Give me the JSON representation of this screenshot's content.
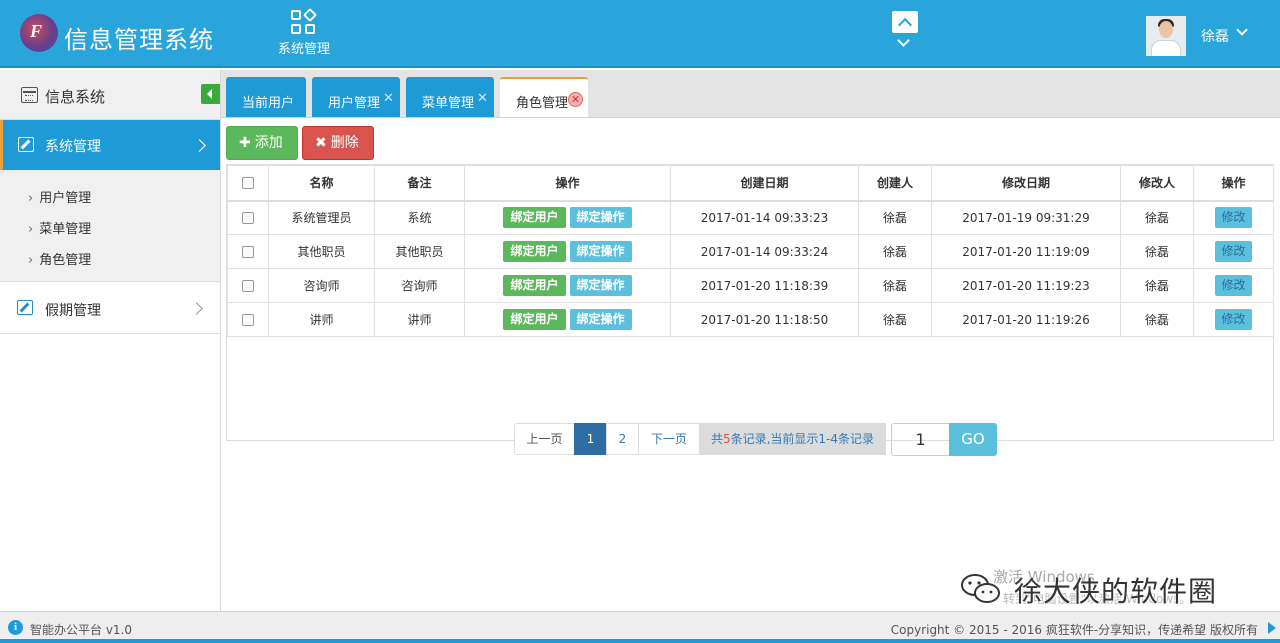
{
  "header": {
    "app_title": "信息管理系统",
    "module_label": "系统管理",
    "user_name": "徐磊"
  },
  "sidebar": {
    "group_label": "信息系统",
    "active_item": "系统管理",
    "sub_items": [
      "用户管理",
      "菜单管理",
      "角色管理"
    ],
    "item2": "假期管理"
  },
  "tabs": [
    {
      "label": "当前用户",
      "closable": false
    },
    {
      "label": "用户管理",
      "closable": true
    },
    {
      "label": "菜单管理",
      "closable": true
    },
    {
      "label": "角色管理",
      "closable": true,
      "active": true
    }
  ],
  "toolbar": {
    "add_label": "添加",
    "delete_label": "删除"
  },
  "table": {
    "columns": [
      "名称",
      "备注",
      "操作",
      "创建日期",
      "创建人",
      "修改日期",
      "修改人",
      "操作"
    ],
    "bind_user_label": "绑定用户",
    "bind_op_label": "绑定操作",
    "edit_label": "修改",
    "rows": [
      {
        "name": "系统管理员",
        "remark": "系统",
        "created": "2017-01-14 09:33:23",
        "creator": "徐磊",
        "modified": "2017-01-19 09:31:29",
        "modifier": "徐磊"
      },
      {
        "name": "其他职员",
        "remark": "其他职员",
        "created": "2017-01-14 09:33:24",
        "creator": "徐磊",
        "modified": "2017-01-20 11:19:09",
        "modifier": "徐磊"
      },
      {
        "name": "咨询师",
        "remark": "咨询师",
        "created": "2017-01-20 11:18:39",
        "creator": "徐磊",
        "modified": "2017-01-20 11:19:23",
        "modifier": "徐磊"
      },
      {
        "name": "讲师",
        "remark": "讲师",
        "created": "2017-01-20 11:18:50",
        "creator": "徐磊",
        "modified": "2017-01-20 11:19:26",
        "modifier": "徐磊"
      }
    ]
  },
  "pager": {
    "prev": "上一页",
    "pages": [
      "1",
      "2"
    ],
    "current": "1",
    "next": "下一页",
    "info_prefix": "共",
    "info_total": "5",
    "info_suffix": "条记录,当前显示1-4条记录",
    "page_input": "1",
    "go": "GO"
  },
  "watermark": {
    "activate": "激活 Windows",
    "activate_sub": "转到\"电脑设置\"以激活 Windows。",
    "brand": "徐大侠的软件圈"
  },
  "footer": {
    "version": "智能办公平台 v1.0",
    "copyright": "Copyright © 2015 - 2016 疯狂软件-分享知识，传递希望 版权所有"
  },
  "colors": {
    "primary": "#29a5dc",
    "success": "#5cb85c",
    "danger": "#d9534f",
    "info": "#5bc0de"
  }
}
